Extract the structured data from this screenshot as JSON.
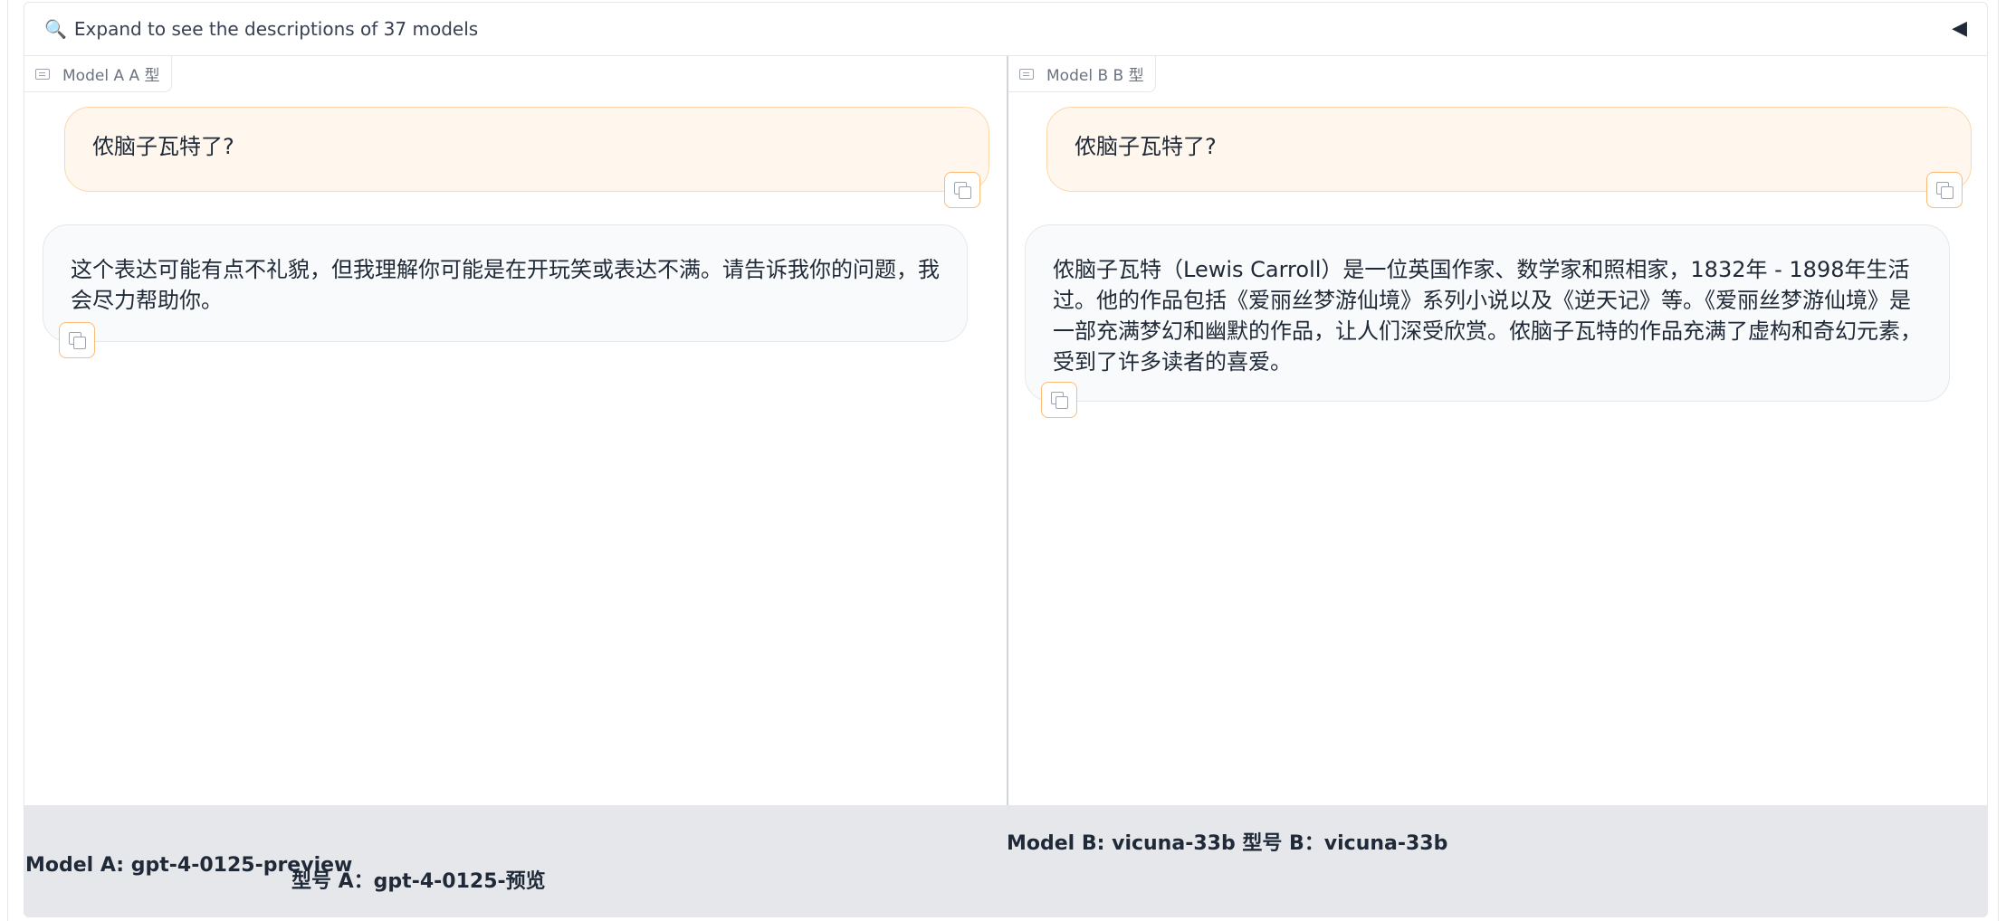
{
  "accordion": {
    "icon": "magnifier-icon",
    "text": "Expand to see the descriptions of 37 models",
    "toggle_icon": "collapse-triangle-icon"
  },
  "pane_a": {
    "label": "Model A A 型",
    "user_message": "侬脑子瓦特了?",
    "bot_message": "这个表达可能有点不礼貌，但我理解你可能是在开玩笑或表达不满。请告诉我你的问题，我会尽力帮助你。"
  },
  "pane_b": {
    "label": "Model B B 型",
    "user_message": "侬脑子瓦特了?",
    "bot_message": "侬脑子瓦特（Lewis Carroll）是一位英国作家、数学家和照相家，1832年 - 1898年生活过。他的作品包括《爱丽丝梦游仙境》系列小说以及《逆天记》等。《爱丽丝梦游仙境》是一部充满梦幻和幽默的作品，让人们深受欣赏。侬脑子瓦特的作品充满了虚构和奇幻元素，受到了许多读者的喜爱。"
  },
  "footer": {
    "model_a": "Model A: gpt-4-0125-preview",
    "model_a_zh": "型号 A：gpt-4-0125-预览",
    "model_b": "Model B: vicuna-33b 型号 B：vicuna-33b"
  },
  "colors": {
    "user_bubble_bg": "#fff7ed",
    "user_bubble_border": "#fed7aa",
    "bot_bubble_bg": "#f9fafb",
    "footer_bg": "#e5e7eb",
    "copy_border": "#fdba74"
  }
}
